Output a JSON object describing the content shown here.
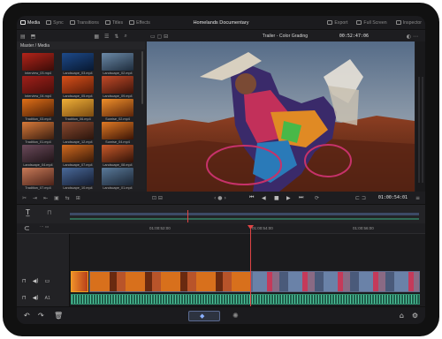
{
  "app": {
    "pages": [
      {
        "label": "Media",
        "icon": "media-icon",
        "active": true
      },
      {
        "label": "Sync",
        "icon": "sync-icon",
        "active": false
      },
      {
        "label": "Transitions",
        "icon": "transitions-icon",
        "active": false
      },
      {
        "label": "Titles",
        "icon": "titles-icon",
        "active": false
      },
      {
        "label": "Effects",
        "icon": "effects-icon",
        "active": false
      }
    ],
    "project_title": "Homelands Documentary",
    "right_actions": [
      {
        "label": "Export",
        "icon": "export-icon"
      },
      {
        "label": "Full Screen",
        "icon": "fullscreen-icon"
      },
      {
        "label": "Inspector",
        "icon": "inspector-icon"
      }
    ]
  },
  "media_pool": {
    "header": "Master / Media",
    "clips": [
      {
        "name": "Interview_03.mp4",
        "c1": "#b3241a",
        "c2": "#3a0c08"
      },
      {
        "name": "Landscape_03.mp4",
        "c1": "#1e4a8a",
        "c2": "#081830"
      },
      {
        "name": "Landscape_02.mp4",
        "c1": "#6c8aa8",
        "c2": "#1e2c3c"
      },
      {
        "name": "Interview_04.mp4",
        "c1": "#a0201a",
        "c2": "#4a0e0a"
      },
      {
        "name": "Landscape_05.mp4",
        "c1": "#d8501a",
        "c2": "#5a1c08"
      },
      {
        "name": "Landscape_09.mp4",
        "c1": "#c24a28",
        "c2": "#3c140a"
      },
      {
        "name": "Tradition_03.mp4",
        "c1": "#e07018",
        "c2": "#4a1e06"
      },
      {
        "name": "Tradition_06.mp4",
        "c1": "#f0b038",
        "c2": "#7a4a10"
      },
      {
        "name": "Sunrise_02.mp4",
        "c1": "#f0902a",
        "c2": "#5a240a"
      },
      {
        "name": "Tradition_01.mp4",
        "c1": "#d87a3a",
        "c2": "#3a1e10"
      },
      {
        "name": "Landscape_12.mp4",
        "c1": "#8a4a30",
        "c2": "#2a140c"
      },
      {
        "name": "Sunrise_04.mp4",
        "c1": "#e07a24",
        "c2": "#3a1406"
      },
      {
        "name": "Landscape_04.mp4",
        "c1": "#6a4a5a",
        "c2": "#201418"
      },
      {
        "name": "Landscape_07.mp4",
        "c1": "#d06a20",
        "c2": "#3a1a08"
      },
      {
        "name": "Landscape_08.mp4",
        "c1": "#c85a2a",
        "c2": "#301208"
      },
      {
        "name": "Tradition_07.mp4",
        "c1": "#c87a58",
        "c2": "#4a2218"
      },
      {
        "name": "Landscape_10.mp4",
        "c1": "#4a6a9a",
        "c2": "#141c30"
      },
      {
        "name": "Landscape_01.mp4",
        "c1": "#5a7a9a",
        "c2": "#1a2432"
      }
    ]
  },
  "viewer": {
    "title": "Trailer - Color Grading",
    "timecode": "00:52:47:06"
  },
  "transport": {
    "timecode": "01:00:54:01",
    "rewind": "⏮",
    "step_back": "◀",
    "stop": "■",
    "play": "▶",
    "forward": "⏭"
  },
  "timeline": {
    "ruler": [
      "01:00:52:00",
      "01:00:54:00",
      "01:00:56:00",
      "01:00:58:00"
    ],
    "video_track_label": "V1",
    "audio_track_label": "A1",
    "playhead_position": 0.4
  },
  "colors": {
    "accent": "#e04444",
    "audio": "#2f8a6c",
    "video_border": "#5d6a8a"
  }
}
